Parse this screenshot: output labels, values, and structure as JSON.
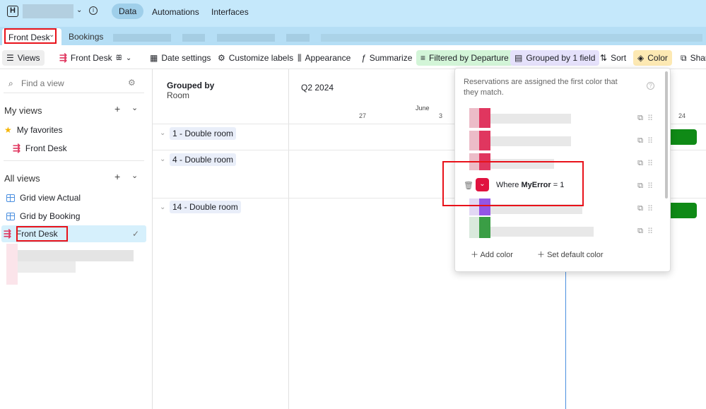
{
  "topbar": {
    "logo": "H",
    "nav": [
      {
        "label": "Data",
        "active": true
      },
      {
        "label": "Automations"
      },
      {
        "label": "Interfaces"
      }
    ]
  },
  "tabs": [
    {
      "label": "Front Desk",
      "active": true
    },
    {
      "label": "Bookings"
    }
  ],
  "toolbar": {
    "views": "Views",
    "view_name": "Front Desk",
    "date_settings": "Date settings",
    "customize_labels": "Customize labels",
    "appearance": "Appearance",
    "summarize": "Summarize",
    "filter": "Filtered by Departure",
    "group": "Grouped by 1 field",
    "sort": "Sort",
    "color": "Color",
    "share": "Share"
  },
  "sidebar": {
    "search_placeholder": "Find a view",
    "my_views": "My views",
    "favorites": "My favorites",
    "favorite_items": [
      "Front Desk"
    ],
    "all_views": "All views",
    "views": [
      {
        "label": "Grid view Actual",
        "icon": "grid-icon"
      },
      {
        "label": "Grid by Booking",
        "icon": "grid-icon"
      },
      {
        "label": "Front Desk",
        "icon": "timeline-icon",
        "selected": true
      }
    ]
  },
  "group_header": {
    "title": "Grouped by",
    "field": "Room"
  },
  "groups": [
    "1 - Double room",
    "4 - Double room",
    "14 - Double room"
  ],
  "timeline": {
    "period": "Q2 2024",
    "month": "June",
    "days": [
      "27",
      "3",
      "24"
    ]
  },
  "color_popup": {
    "description": "Reservations are assigned the first color that they match.",
    "rule_prefix": "Where",
    "rule_field": "MyError",
    "rule_op": "=",
    "rule_value": "1",
    "rule_color": "#e0123f",
    "add_color": "Add color",
    "set_default": "Set default color"
  },
  "colors": {
    "accent": "#c5e8fb",
    "filter": "#d3f5d8",
    "group": "#e5e1fb",
    "color_btn": "#fde9b3",
    "bar": "#0f8a16"
  }
}
